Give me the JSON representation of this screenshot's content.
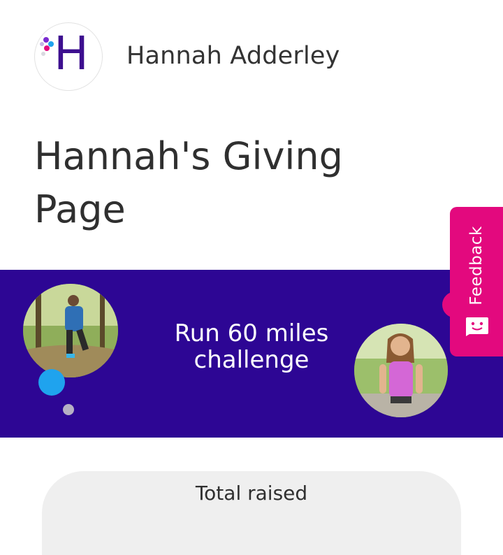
{
  "header": {
    "logo_letter": "H",
    "owner_name": "Hannah Adderley"
  },
  "page": {
    "title": "Hannah's Giving Page"
  },
  "banner": {
    "challenge_line1": "Run 60 miles",
    "challenge_line2": "challenge",
    "background_color": "#2d0694"
  },
  "feedback": {
    "label": "Feedback",
    "icon": "chat-smile-icon",
    "color": "#e3097e"
  },
  "totals": {
    "label": "Total raised"
  },
  "colors": {
    "brand_purple": "#3d0f8f",
    "accent_blue": "#1fa3ee"
  }
}
